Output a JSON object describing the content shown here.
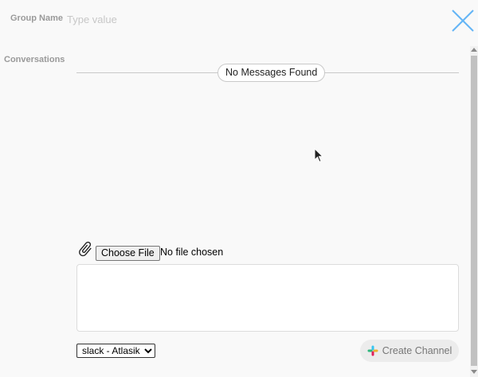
{
  "header": {
    "group_name_label": "Group Name",
    "group_name_placeholder": "Type value",
    "group_name_value": ""
  },
  "conversations": {
    "label": "Conversations",
    "empty_message": "No Messages Found"
  },
  "composer": {
    "choose_file_label": "Choose File",
    "file_status": "No file chosen",
    "message_value": ""
  },
  "footer": {
    "workspace_selected": "slack - Atlasiko",
    "create_channel_label": "Create Channel"
  },
  "colors": {
    "close_icon": "#64b5f6",
    "button_bg": "#ececec",
    "muted_text": "#9a9a9a"
  },
  "icons": {
    "close": "close-icon",
    "attach": "paperclip-icon",
    "slack": "slack-icon",
    "cursor": "mouse-cursor-icon"
  }
}
